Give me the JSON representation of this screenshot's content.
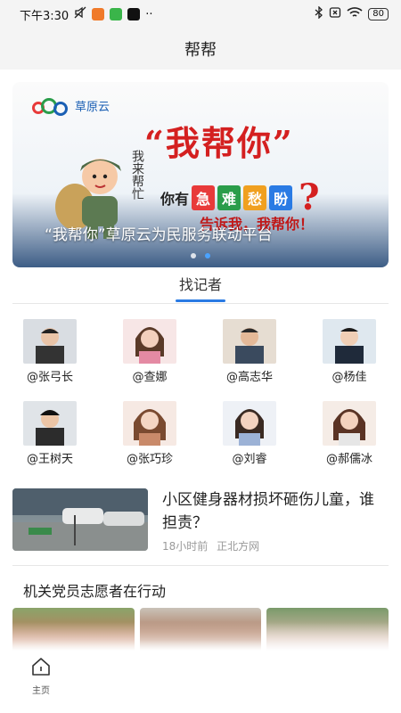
{
  "status_bar": {
    "time": "下午3:30",
    "more": "··",
    "battery": "80",
    "icons": [
      "mute-icon",
      "app-icon",
      "download-icon",
      "tiktok-icon",
      "bluetooth-icon",
      "sim-icon",
      "wifi-icon",
      "battery-icon"
    ]
  },
  "header": {
    "title": "帮帮"
  },
  "banner": {
    "logo_name": "草原云",
    "slogan_main": "“我帮你”",
    "slogan_prefix": "你有",
    "tags": [
      "急",
      "难",
      "愁",
      "盼"
    ],
    "tag_colors": [
      "#e83a3a",
      "#2a9d4a",
      "#f0a020",
      "#2a7be4"
    ],
    "question_mark": "?",
    "vertical_text": "我来帮忙",
    "tell_me": "告诉我，我帮你！",
    "caption": "“我帮你”草原云为民服务联动平台",
    "page_count": 2,
    "active_page": 2
  },
  "section_tab": {
    "label": "找记者"
  },
  "reporters": [
    {
      "name": "@张弓长"
    },
    {
      "name": "@查娜"
    },
    {
      "name": "@高志华"
    },
    {
      "name": "@杨佳"
    },
    {
      "name": "@王树天"
    },
    {
      "name": "@张巧珍"
    },
    {
      "name": "@刘睿"
    },
    {
      "name": "@郝儒冰"
    }
  ],
  "news": {
    "title": "小区健身器材损坏砸伤儿童，谁担责？",
    "time": "18小时前",
    "source": "正北方网"
  },
  "section2": {
    "title": "机关党员志愿者在行动"
  },
  "bottom_nav": {
    "home_label": "主页"
  },
  "colors": {
    "accent": "#2a7be4",
    "slogan_red": "#d42020"
  }
}
